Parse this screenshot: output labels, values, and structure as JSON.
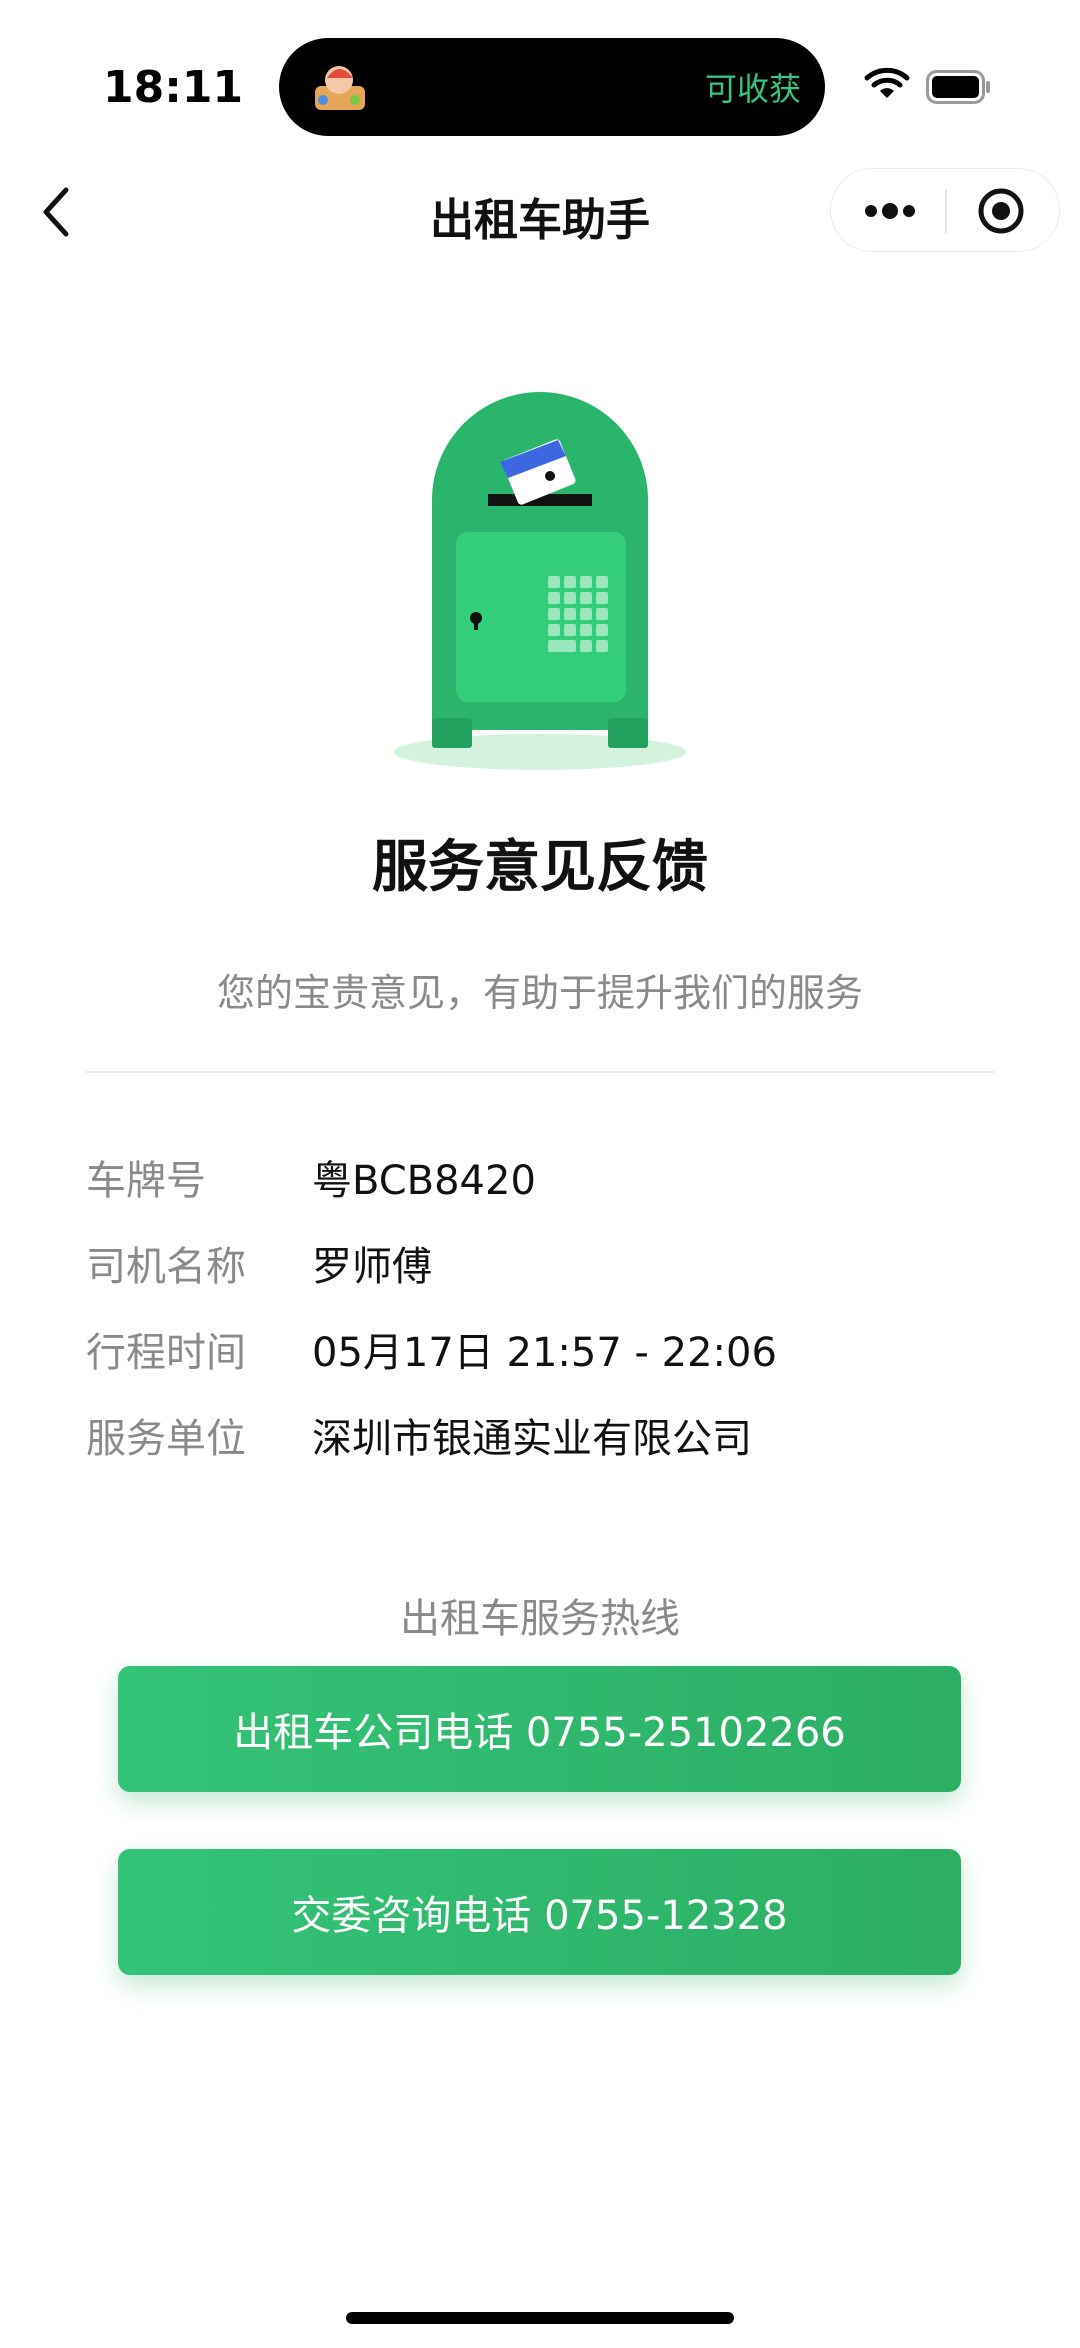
{
  "status_bar": {
    "time": "18:11",
    "island_label": "可收获"
  },
  "nav": {
    "title": "出租车助手"
  },
  "feedback": {
    "heading": "服务意见反馈",
    "subtitle": "您的宝贵意见，有助于提升我们的服务"
  },
  "info": [
    {
      "label": "车牌号",
      "value": "粤BCB8420"
    },
    {
      "label": "司机名称",
      "value": "罗师傅"
    },
    {
      "label": "行程时间",
      "value": "05月17日 21:57 - 22:06"
    },
    {
      "label": "服务单位",
      "value": "深圳市银通实业有限公司"
    }
  ],
  "hotline": {
    "title": "出租车服务热线",
    "company_button": "出租车公司电话 0755-25102266",
    "commission_button": "交委咨询电话 0755-12328"
  },
  "colors": {
    "accent": "#2eb56c",
    "label_gray": "#8a8a8a"
  },
  "icons": [
    "back-chevron-icon",
    "more-dots-icon",
    "target-icon",
    "wifi-icon",
    "battery-icon",
    "mailbox-icon"
  ]
}
